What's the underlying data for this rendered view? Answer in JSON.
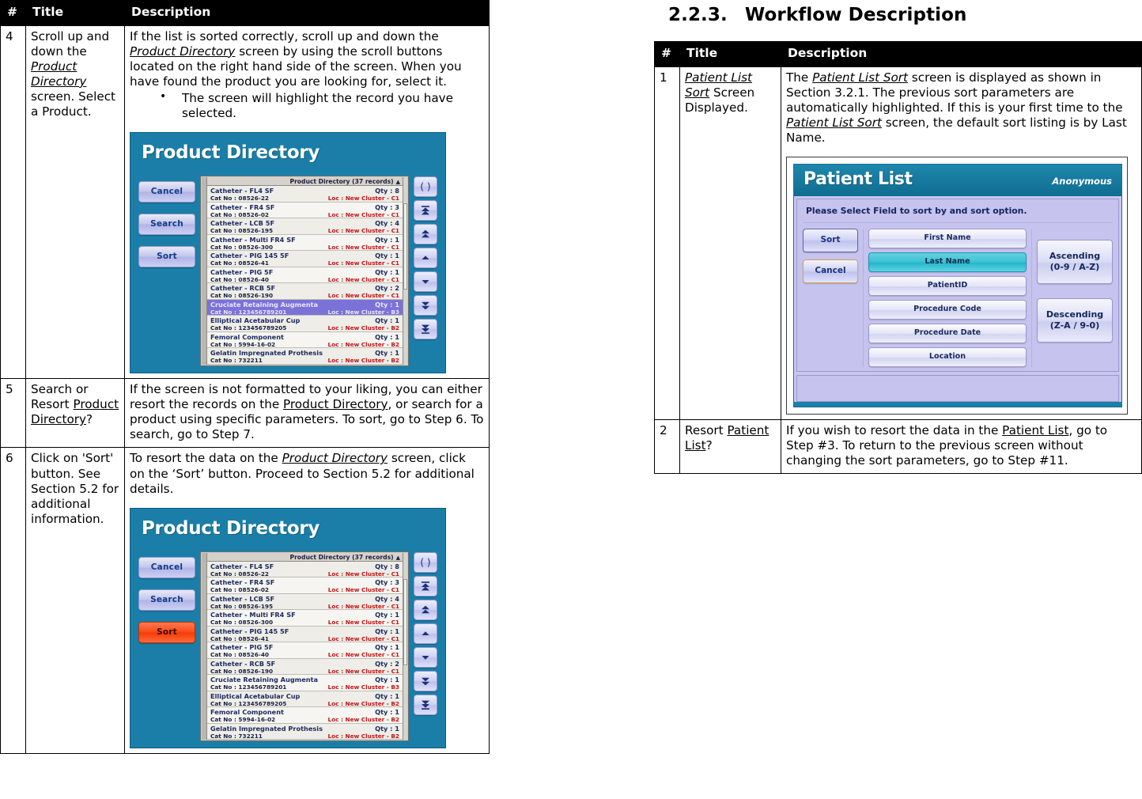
{
  "left_table": {
    "headers": {
      "num": "#",
      "title": "Title",
      "description": "Description"
    },
    "rows": [
      {
        "num": "4",
        "title_parts": [
          {
            "t": "Scroll up and down the ",
            "s": "plain"
          },
          {
            "t": "Product Directory",
            "s": "it"
          },
          {
            "t": " screen.  Select a Product.",
            "s": "plain"
          }
        ],
        "desc_parts": [
          {
            "t": "If the list is sorted correctly, scroll up and down the ",
            "s": "plain"
          },
          {
            "t": "Product Directory",
            "s": "it"
          },
          {
            "t": " screen by using the scroll buttons located on the right hand side of the screen.  When you have found the product you are looking for, select it.",
            "s": "plain"
          }
        ],
        "bullets": [
          "The screen will highlight the record you have selected."
        ],
        "screenshot": "product-directory-selected"
      },
      {
        "num": "5",
        "title_parts": [
          {
            "t": "Search or Resort ",
            "s": "plain"
          },
          {
            "t": "Product Directory",
            "s": "ul"
          },
          {
            "t": "?",
            "s": "plain"
          }
        ],
        "desc_parts": [
          {
            "t": "If the screen is not formatted to your liking, you can either resort the records on the ",
            "s": "plain"
          },
          {
            "t": "Product Directory",
            "s": "ul"
          },
          {
            "t": ", or search for a product using specific parameters.  To sort, go to Step 6.  To search, go to Step 7.",
            "s": "plain"
          }
        ],
        "bullets": [],
        "screenshot": null
      },
      {
        "num": "6",
        "title_parts": [
          {
            "t": "Click on 'Sort' button.  See Section 5.2 for additional information.",
            "s": "plain"
          }
        ],
        "desc_parts": [
          {
            "t": "To resort the data on the ",
            "s": "plain"
          },
          {
            "t": "Product Directory",
            "s": "it"
          },
          {
            "t": " screen, click on the ‘Sort’ button.  Proceed to Section 5.2 for additional details.",
            "s": "plain"
          }
        ],
        "bullets": [],
        "screenshot": "product-directory-sort-pressed"
      }
    ]
  },
  "section": {
    "number": "2.2.3.",
    "heading": "Workflow Description"
  },
  "right_table": {
    "headers": {
      "num": "#",
      "title": "Title",
      "description": "Description"
    },
    "rows": [
      {
        "num": "1",
        "title_parts": [
          {
            "t": "Patient List Sort",
            "s": "it"
          },
          {
            "t": " Screen Displayed.",
            "s": "plain"
          }
        ],
        "desc_parts": [
          {
            "t": "The ",
            "s": "plain"
          },
          {
            "t": "Patient List Sort",
            "s": "it"
          },
          {
            "t": " screen is displayed as shown in Section 3.2.1.  The previous sort parameters are automatically highlighted.  If this is your first time to the ",
            "s": "plain"
          },
          {
            "t": "Patient List Sort",
            "s": "it"
          },
          {
            "t": " screen, the default sort listing is by Last Name.",
            "s": "plain"
          }
        ],
        "bullets": [],
        "screenshot": "patient-list-sort"
      },
      {
        "num": "2",
        "title_parts": [
          {
            "t": "Resort ",
            "s": "plain"
          },
          {
            "t": "Patient List",
            "s": "ul"
          },
          {
            "t": "?",
            "s": "plain"
          }
        ],
        "desc_parts": [
          {
            "t": "If you wish to resort the data in the ",
            "s": "plain"
          },
          {
            "t": "Patient List",
            "s": "ul"
          },
          {
            "t": ", go to Step #3.  To return to the previous screen without changing the sort parameters, go to Step #11.",
            "s": "plain"
          }
        ],
        "bullets": [],
        "screenshot": null
      }
    ]
  },
  "product_directory_screen": {
    "title": "Product Directory",
    "buttons": [
      "Cancel",
      "Search",
      "Sort"
    ],
    "list_header": "Product Directory (37 records)",
    "nav_buttons": [
      "refresh-icon",
      "scroll-to-top-icon",
      "page-up-icon",
      "line-up-icon",
      "line-down-icon",
      "page-down-icon",
      "scroll-to-bottom-icon"
    ],
    "records": [
      {
        "name": "Catheter - FL4 SF",
        "qty": "Qty : 8",
        "cat": "Cat No : 08526-22",
        "loc": "Loc : New Cluster -  C1"
      },
      {
        "name": "Catheter - FR4 SF",
        "qty": "Qty : 3",
        "cat": "Cat No : 08526-02",
        "loc": "Loc : New Cluster -  C1"
      },
      {
        "name": "Catheter - LCB 5F",
        "qty": "Qty : 4",
        "cat": "Cat No : 08526-195",
        "loc": "Loc : New Cluster -  C1"
      },
      {
        "name": "Catheter - Multi FR4 SF",
        "qty": "Qty : 1",
        "cat": "Cat No : 08526-300",
        "loc": "Loc : New Cluster -  C1"
      },
      {
        "name": "Catheter - PIG 145 5F",
        "qty": "Qty : 1",
        "cat": "Cat No : 08526-41",
        "loc": "Loc : New Cluster -  C1"
      },
      {
        "name": "Catheter - PIG 5F",
        "qty": "Qty : 1",
        "cat": "Cat No : 08526-40",
        "loc": "Loc : New Cluster -  C1"
      },
      {
        "name": "Catheter - RCB 5F",
        "qty": "Qty : 2",
        "cat": "Cat No : 08526-190",
        "loc": "Loc : New Cluster -  C1"
      },
      {
        "name": "Cruciate Retaining Augmenta",
        "qty": "Qty : 1",
        "cat": "Cat No : 123456789201",
        "loc": "Loc : New Cluster -  B3"
      },
      {
        "name": "Elliptical Acetabular Cup",
        "qty": "Qty : 1",
        "cat": "Cat No : 123456789205",
        "loc": "Loc : New Cluster -  B2"
      },
      {
        "name": "Femoral Component",
        "qty": "Qty : 1",
        "cat": "Cat No : 5994-16-02",
        "loc": "Loc : New Cluster -  B2"
      },
      {
        "name": "Gelatin Impregnated Prothesis",
        "qty": "Qty : 1",
        "cat": "Cat No : 732211",
        "loc": "Loc : New Cluster -  B2"
      }
    ],
    "selected_record_index": 7,
    "sort_button_pressed_color": "#f9450f"
  },
  "patient_list_screen": {
    "title": "Patient List",
    "user": "Anonymous",
    "instruction": "Please Select Field to sort by and sort option.",
    "action_buttons": [
      {
        "label": "Sort",
        "state": "normal"
      },
      {
        "label": "Cancel",
        "state": "focused"
      }
    ],
    "sort_fields": [
      {
        "label": "First Name",
        "selected": false
      },
      {
        "label": "Last Name",
        "selected": true
      },
      {
        "label": "PatientID",
        "selected": false
      },
      {
        "label": "Procedure Code",
        "selected": false
      },
      {
        "label": "Procedure Date",
        "selected": false
      },
      {
        "label": "Location",
        "selected": false
      }
    ],
    "sort_options": [
      {
        "line1": "Ascending",
        "line2": "(0-9 / A-Z)"
      },
      {
        "line1": "Descending",
        "line2": "(Z-A / 9-0)"
      }
    ],
    "accent_color": "#1b7fa6",
    "highlight_color": "#3fc3d6"
  }
}
